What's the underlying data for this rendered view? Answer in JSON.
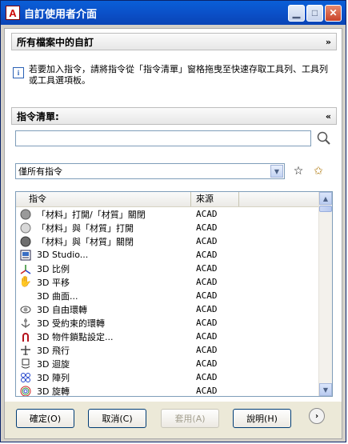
{
  "window": {
    "title": "自訂使用者介面"
  },
  "section_all": {
    "title": "所有檔案中的自訂"
  },
  "info": {
    "text": "若要加入指令，請將指令從「指令清單」窗格拖曳至快速存取工具列、工具列或工具選項板。"
  },
  "section_cmds": {
    "title": "指令清單:"
  },
  "search": {
    "value": "",
    "placeholder": ""
  },
  "filter": {
    "selected": "僅所有指令"
  },
  "list": {
    "headers": {
      "command": "指令",
      "source": "來源"
    },
    "rows": [
      {
        "icon": "material-sphere-gray-icon",
        "command": "「材料」打開/「材質」關閉",
        "source": "ACAD"
      },
      {
        "icon": "material-sphere-light-icon",
        "command": "「材料」與「材質」打開",
        "source": "ACAD"
      },
      {
        "icon": "material-sphere-dark-icon",
        "command": "「材料」與「材質」關閉",
        "source": "ACAD"
      },
      {
        "icon": "3d-studio-icon",
        "command": "3D Studio...",
        "source": "ACAD"
      },
      {
        "icon": "3d-scale-icon",
        "command": "3D 比例",
        "source": "ACAD"
      },
      {
        "icon": "hand-pan-icon",
        "command": "3D 平移",
        "source": "ACAD"
      },
      {
        "icon": "",
        "command": "3D 曲面...",
        "source": "ACAD"
      },
      {
        "icon": "free-orbit-icon",
        "command": "3D 自由環轉",
        "source": "ACAD"
      },
      {
        "icon": "constrained-orbit-icon",
        "command": "3D 受約束的環轉",
        "source": "ACAD"
      },
      {
        "icon": "object-snap-magnet-icon",
        "command": "3D 物件鎖點設定...",
        "source": "ACAD"
      },
      {
        "icon": "fly-icon",
        "command": "3D 飛行",
        "source": "ACAD"
      },
      {
        "icon": "3d-swivel-icon",
        "command": "3D 迴旋",
        "source": "ACAD"
      },
      {
        "icon": "3d-array-icon",
        "command": "3D 陣列",
        "source": "ACAD"
      },
      {
        "icon": "3d-rotate-icon",
        "command": "3D 旋轉",
        "source": "ACAD"
      }
    ]
  },
  "buttons": {
    "ok": "確定(O)",
    "cancel": "取消(C)",
    "apply": "套用(A)",
    "help": "說明(H)"
  }
}
